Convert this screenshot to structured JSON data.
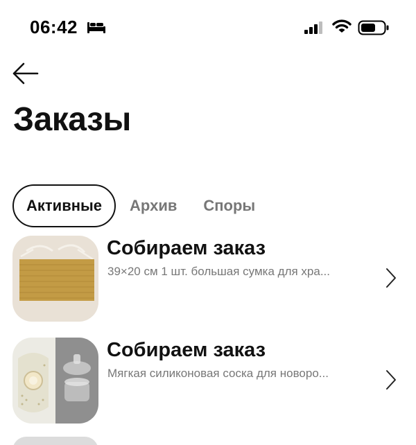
{
  "status_bar": {
    "time": "06:42",
    "icons": [
      "bed-icon",
      "signal-icon",
      "wifi-icon",
      "battery-icon"
    ]
  },
  "header": {
    "back_icon": "arrow-left-icon",
    "title": "Заказы"
  },
  "tabs": [
    {
      "label": "Активные",
      "active": true
    },
    {
      "label": "Архив",
      "active": false
    },
    {
      "label": "Споры",
      "active": false
    }
  ],
  "orders": [
    {
      "status": "Собираем заказ",
      "description": "39×20 см 1 шт. большая сумка для хра...",
      "thumb": "woven-bag-photo"
    },
    {
      "status": "Собираем заказ",
      "description": "Мягкая силиконовая соска для новоро...",
      "thumb": "pacifier-photo"
    }
  ],
  "colors": {
    "text_primary": "#111111",
    "text_secondary": "#777777",
    "background": "#ffffff"
  }
}
